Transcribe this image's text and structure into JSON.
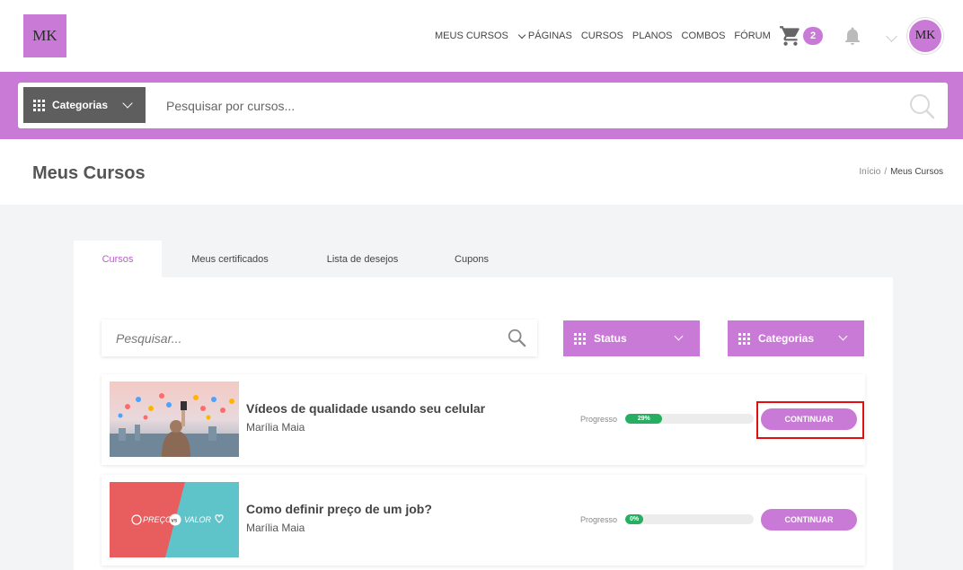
{
  "brand": {
    "logo_text": "MK",
    "avatar_text": "MK",
    "accent": "#c97ad6"
  },
  "nav": {
    "items": [
      "MEUS CURSOS",
      "PÁGINAS",
      "CURSOS",
      "PLANOS",
      "COMBOS",
      "FÓRUM"
    ]
  },
  "cart": {
    "count": "2"
  },
  "search_bar": {
    "categories_label": "Categorias",
    "placeholder": "Pesquisar por cursos..."
  },
  "page": {
    "title": "Meus Cursos",
    "breadcrumb": [
      "Início",
      "/",
      "Meus Cursos"
    ]
  },
  "tabs": [
    {
      "label": "Cursos",
      "active": true
    },
    {
      "label": "Meus certificados",
      "active": false
    },
    {
      "label": "Lista de desejos",
      "active": false
    },
    {
      "label": "Cupons",
      "active": false
    }
  ],
  "filters": {
    "search_placeholder": "Pesquisar...",
    "status_label": "Status",
    "categories_label": "Categorias"
  },
  "courses": [
    {
      "title": "Vídeos de qualidade usando seu celular",
      "author": "Marília Maia",
      "progress_label": "Progresso",
      "progress": 29,
      "progress_text": "29%",
      "button": "CONTINUAR"
    },
    {
      "title": "Como definir preço de um job?",
      "author": "Marília Maia",
      "progress_label": "Progresso",
      "progress": 0,
      "progress_text": "0%",
      "button": "CONTINUAR",
      "thumb_text": {
        "left": "PREÇO",
        "vs": "vs",
        "right": "VALOR"
      }
    }
  ]
}
